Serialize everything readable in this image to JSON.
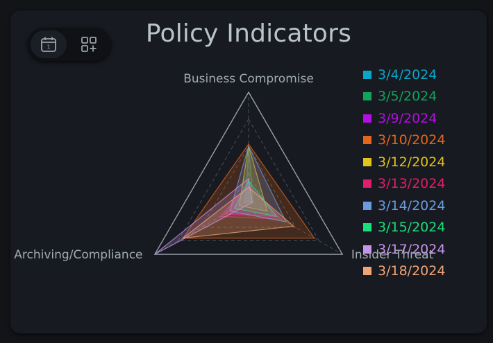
{
  "title": "Policy Indicators",
  "toolbar": {
    "buttons": [
      {
        "icon": "calendar-icon",
        "glyph": "1"
      },
      {
        "icon": "add-widget-icon"
      }
    ]
  },
  "chart_data": {
    "type": "radar",
    "title": "Policy Indicators",
    "axes": [
      "Business Compromise",
      "Insider Threat",
      "Archiving/Compliance"
    ],
    "range": [
      0,
      100
    ],
    "grid": true,
    "legend_position": "right",
    "series": [
      {
        "name": "3/4/2024",
        "color": "#0aa6c8",
        "values": [
          20,
          2,
          5
        ]
      },
      {
        "name": "3/5/2024",
        "color": "#10a35a",
        "values": [
          50,
          5,
          3
        ]
      },
      {
        "name": "3/9/2024",
        "color": "#b20fe0",
        "values": [
          14,
          30,
          25
        ]
      },
      {
        "name": "3/10/2024",
        "color": "#e2661d",
        "values": [
          52,
          70,
          70
        ]
      },
      {
        "name": "3/12/2024",
        "color": "#e3c21a",
        "values": [
          50,
          20,
          10
        ]
      },
      {
        "name": "3/13/2024",
        "color": "#e21c6e",
        "values": [
          15,
          35,
          30
        ]
      },
      {
        "name": "3/14/2024",
        "color": "#6a9be0",
        "values": [
          50,
          40,
          20
        ]
      },
      {
        "name": "3/15/2024",
        "color": "#18e07a",
        "values": [
          18,
          30,
          15
        ]
      },
      {
        "name": "3/17/2024",
        "color": "#c595ea",
        "values": [
          20,
          4,
          100
        ]
      },
      {
        "name": "3/18/2024",
        "color": "#f0a575",
        "values": [
          12,
          48,
          70
        ]
      }
    ]
  }
}
